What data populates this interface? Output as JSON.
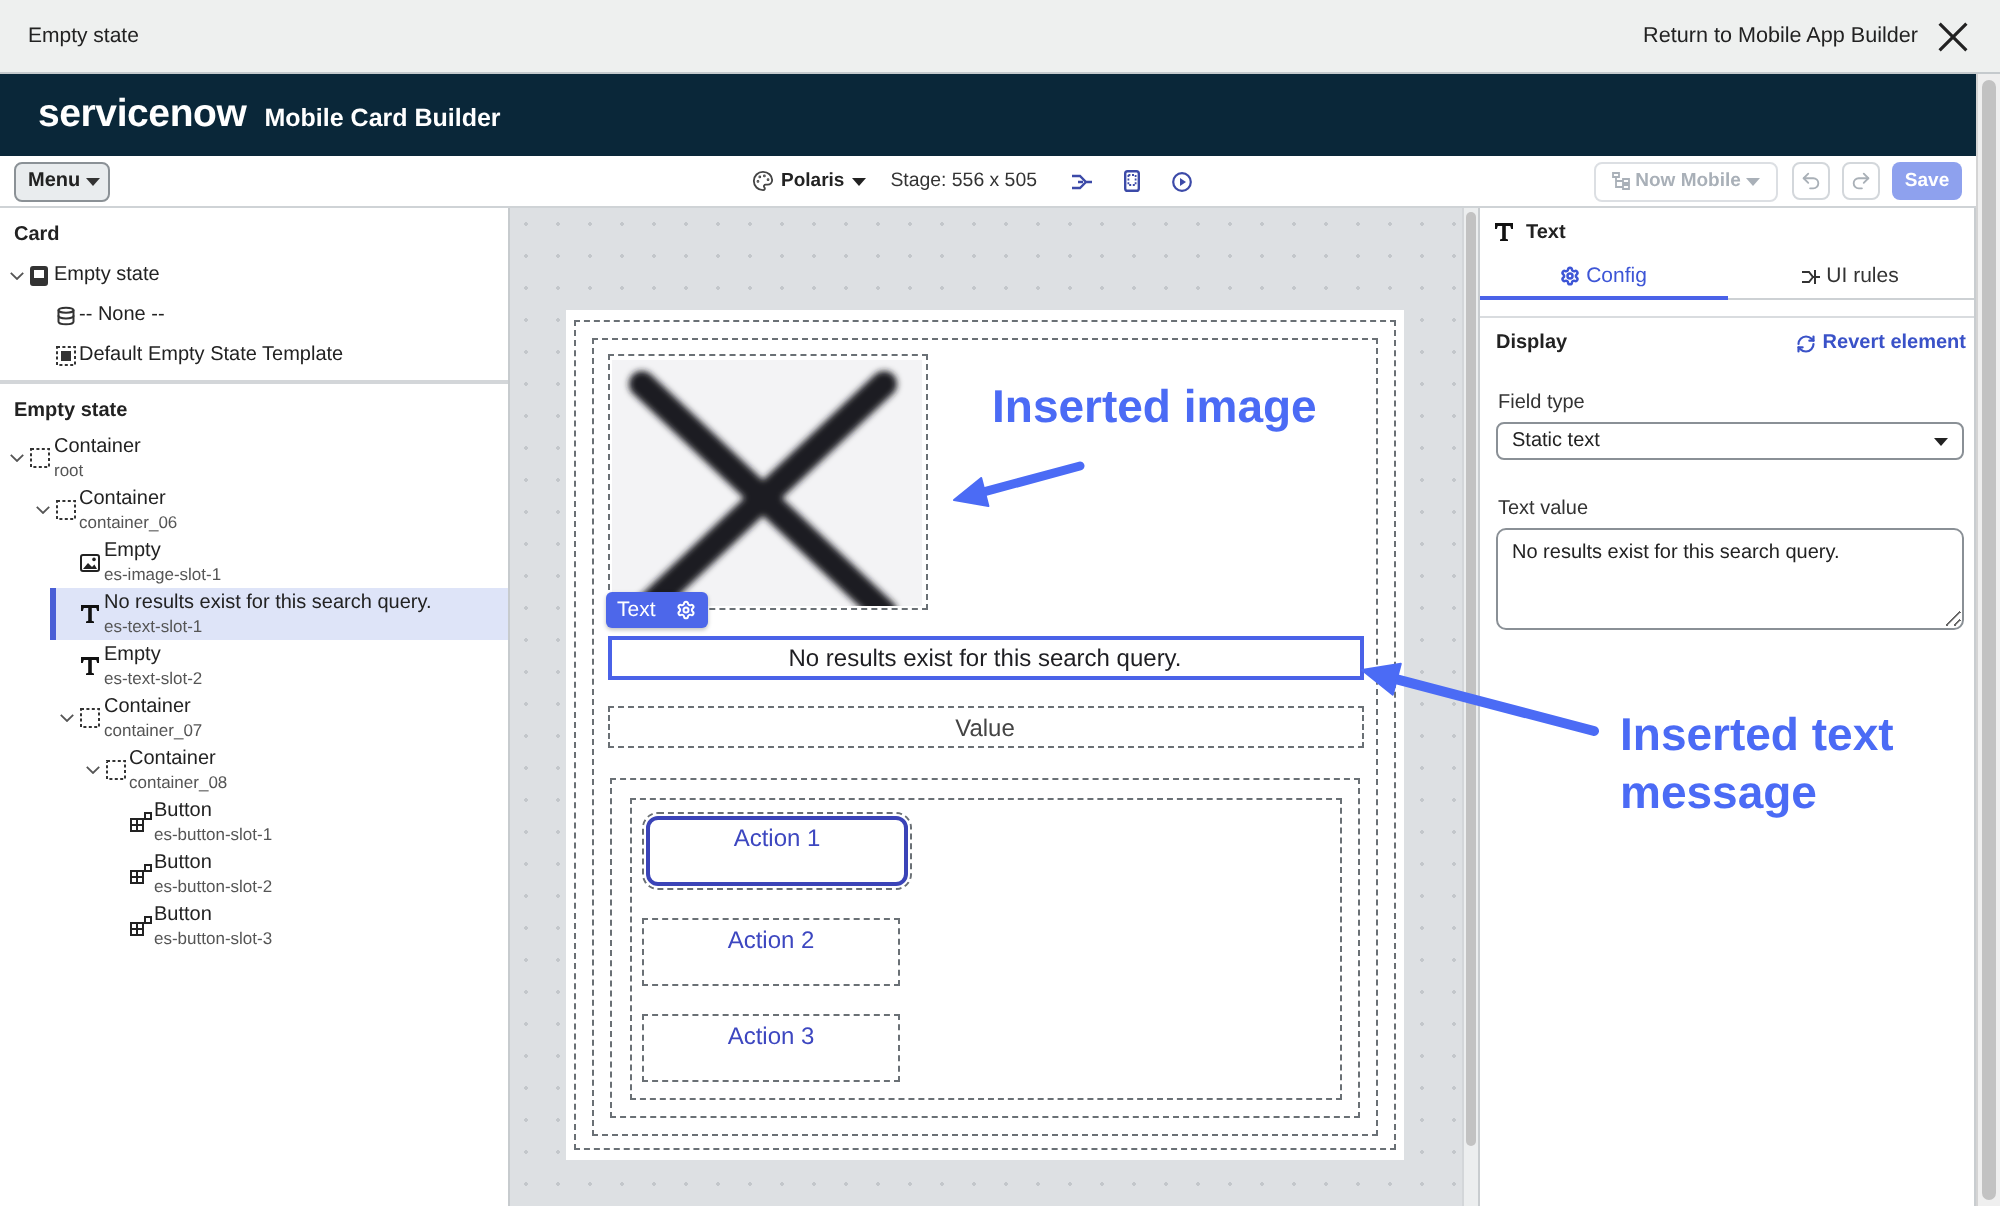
{
  "window": {
    "title": "Empty state",
    "return_link": "Return to Mobile App Builder"
  },
  "header": {
    "logo": "servicenow",
    "app_name": "Mobile Card Builder"
  },
  "toolbar": {
    "menu": "Menu",
    "theme": "Polaris",
    "stage": "Stage: 556 x 505",
    "scope": {
      "label": "Now Mobile",
      "disabled": true
    },
    "history": [
      {
        "kind": "undo",
        "disabled": true
      },
      {
        "kind": "redo",
        "disabled": true
      }
    ],
    "save": {
      "label": "Save",
      "disabled": true
    }
  },
  "card_panel": {
    "title": "Card",
    "tree": [
      {
        "label": "Empty state",
        "kind": "card",
        "expanded": true,
        "selected": false,
        "children": [
          {
            "label": "-- None --",
            "kind": "table",
            "selected": false
          },
          {
            "label": "Default Empty State Template",
            "kind": "template",
            "selected": false
          }
        ]
      }
    ]
  },
  "layout_panel": {
    "title": "Empty state",
    "tree": [
      {
        "label": "Container",
        "sublabel": "root",
        "kind": "container",
        "expanded": true,
        "selected": false,
        "children": [
          {
            "label": "Container",
            "sublabel": "container_06",
            "kind": "container",
            "expanded": true,
            "selected": false,
            "children": [
              {
                "label": "Empty",
                "sublabel": "es-image-slot-1",
                "kind": "image",
                "selected": false
              },
              {
                "label": "No results exist for this search query.",
                "sublabel": "es-text-slot-1",
                "kind": "text",
                "selected": true
              },
              {
                "label": "Empty",
                "sublabel": "es-text-slot-2",
                "kind": "text",
                "selected": false
              },
              {
                "label": "Container",
                "sublabel": "container_07",
                "kind": "container",
                "expanded": true,
                "selected": false,
                "children": [
                  {
                    "label": "Container",
                    "sublabel": "container_08",
                    "kind": "container",
                    "expanded": true,
                    "selected": false,
                    "children": [
                      {
                        "label": "Button",
                        "sublabel": "es-button-slot-1",
                        "kind": "button",
                        "selected": false
                      },
                      {
                        "label": "Button",
                        "sublabel": "es-button-slot-2",
                        "kind": "button",
                        "selected": false
                      },
                      {
                        "label": "Button",
                        "sublabel": "es-button-slot-3",
                        "kind": "button",
                        "selected": false
                      }
                    ]
                  }
                ]
              }
            ]
          }
        ]
      }
    ]
  },
  "canvas": {
    "slots": [
      {
        "kind": "image",
        "selected": false
      },
      {
        "kind": "text",
        "text": "No results exist for this search query.",
        "selected": true,
        "tag": "Text"
      },
      {
        "kind": "text",
        "text": "Value",
        "selected": false
      }
    ],
    "actions": [
      {
        "label": "Action 1",
        "hovered": true
      },
      {
        "label": "Action 2",
        "hovered": false
      },
      {
        "label": "Action 3",
        "hovered": false
      }
    ]
  },
  "properties": {
    "title": "Text",
    "tabs": [
      {
        "label": "Config",
        "selected": true
      },
      {
        "label": "UI rules",
        "selected": false
      }
    ],
    "section": "Display",
    "revert": "Revert element",
    "fields": [
      {
        "kind": "select",
        "label": "Field type",
        "value": "Static text"
      },
      {
        "kind": "textarea",
        "label": "Text value",
        "value": "No results exist for this search query."
      }
    ]
  },
  "annotations": [
    {
      "text": "Inserted image"
    },
    {
      "text": "Inserted text message"
    }
  ]
}
